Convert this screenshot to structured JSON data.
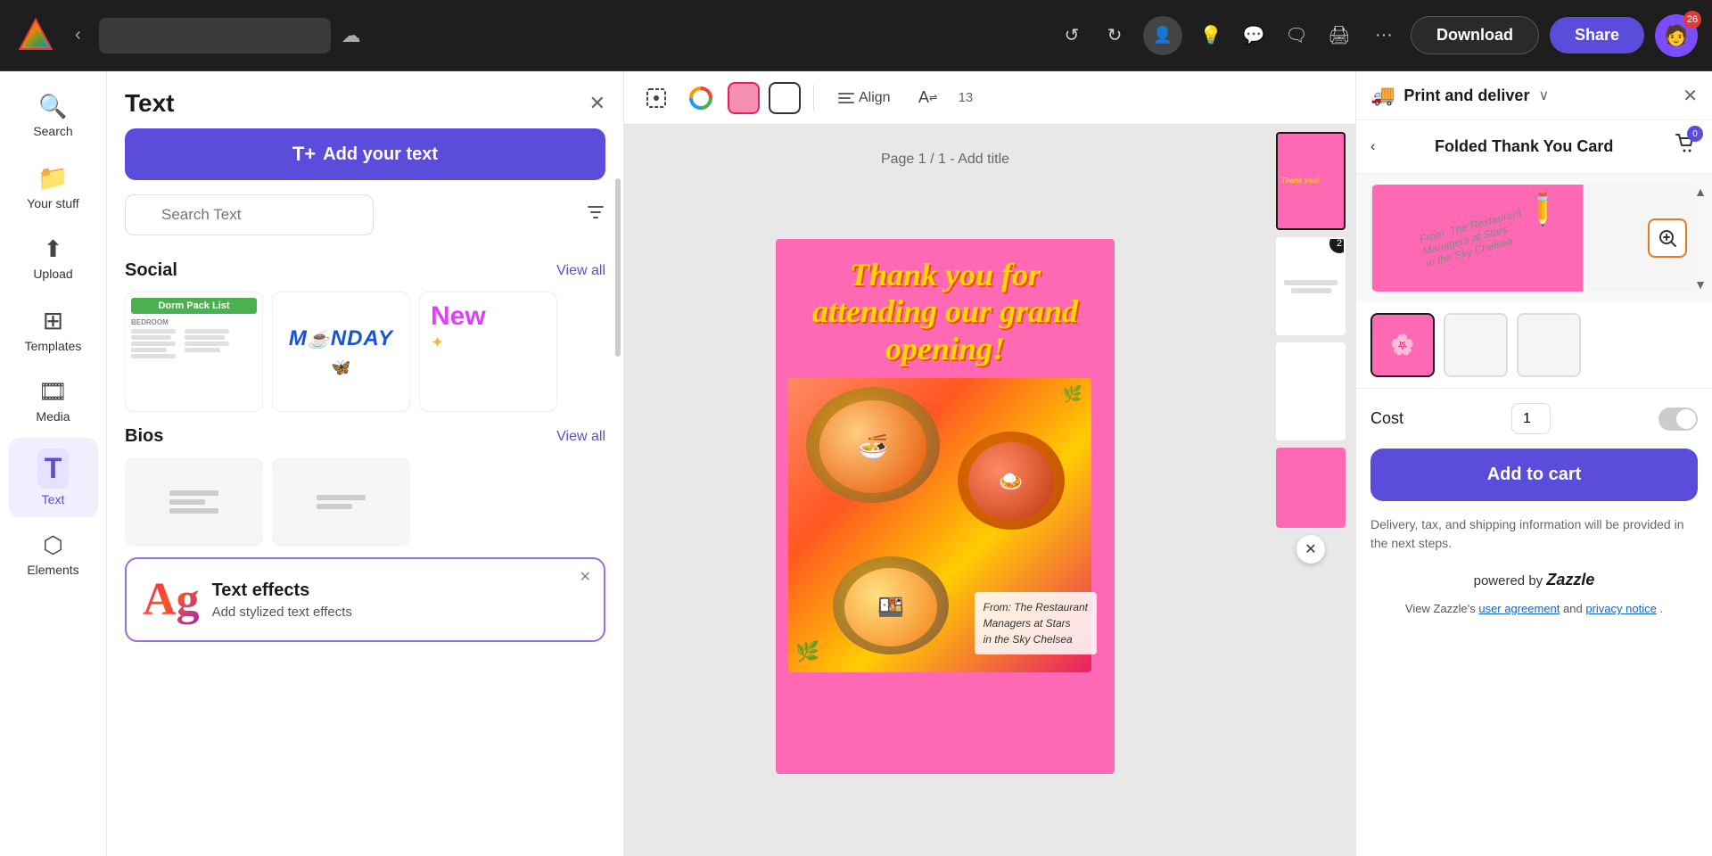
{
  "topbar": {
    "back_label": "‹",
    "undo_label": "↺",
    "redo_label": "↻",
    "add_person_icon": "👤+",
    "lightbulb_icon": "💡",
    "comment_icon": "💬",
    "comments2_icon": "🗨",
    "print_icon": "🖨",
    "more_icon": "···",
    "download_label": "Download",
    "share_label": "Share",
    "avatar_count": "26"
  },
  "sidebar": {
    "items": [
      {
        "id": "search",
        "icon": "🔍",
        "label": "Search"
      },
      {
        "id": "your-stuff",
        "icon": "📁",
        "label": "Your stuff"
      },
      {
        "id": "upload",
        "icon": "⬆",
        "label": "Upload"
      },
      {
        "id": "templates",
        "icon": "⊞",
        "label": "Templates"
      },
      {
        "id": "media",
        "icon": "🎞",
        "label": "Media"
      },
      {
        "id": "text",
        "icon": "T",
        "label": "Text",
        "active": true
      },
      {
        "id": "elements",
        "icon": "⬡",
        "label": "Elements"
      }
    ]
  },
  "text_panel": {
    "title": "Text",
    "close_icon": "✕",
    "add_text_icon": "T+",
    "add_text_label": "Add your text",
    "search_placeholder": "Search Text",
    "filter_icon": "⊿",
    "sections": [
      {
        "id": "social",
        "title": "Social",
        "view_all": "View all",
        "templates": [
          {
            "id": "dorm",
            "type": "dorm"
          },
          {
            "id": "monday",
            "type": "monday"
          },
          {
            "id": "new",
            "type": "new"
          }
        ]
      },
      {
        "id": "bios",
        "title": "Bios",
        "view_all": "View all"
      }
    ],
    "text_effects": {
      "ag_text": "Ag",
      "title": "Text effects",
      "subtitle": "Add stylized text effects",
      "close": "✕"
    }
  },
  "canvas": {
    "page_label": "Page 1 / 1",
    "add_title": "- Add title",
    "toolbar": {
      "align_label": "Align",
      "translate_label": "A",
      "page_count": "13"
    },
    "card": {
      "thank_you_text": "Thank you for attending our grand opening!",
      "signature": "From: The Restaurant\nManagers at Stars\nin the Sky Chelsea"
    }
  },
  "thumbnails": {
    "badge_2": "2",
    "close_icon": "✕"
  },
  "print_panel": {
    "header": {
      "icon": "🚚",
      "title": "Print and deliver",
      "collapse_icon": "∨",
      "close_icon": "✕"
    },
    "nav": {
      "back_icon": "‹",
      "card_title": "Folded Thank You Card",
      "cart_badge": "0"
    },
    "cost": {
      "label": "Cost",
      "qty": "1"
    },
    "add_to_cart_label": "Add to cart",
    "delivery_note": "Delivery, tax, and shipping information will be provided in the next steps.",
    "powered_by": "powered by",
    "zazzle": "Zazzle",
    "user_agreement": "user agreement",
    "privacy_notice": "privacy notice",
    "footer_text": "View Zazzle's",
    "footer_and": "and",
    "footer_period": "."
  }
}
